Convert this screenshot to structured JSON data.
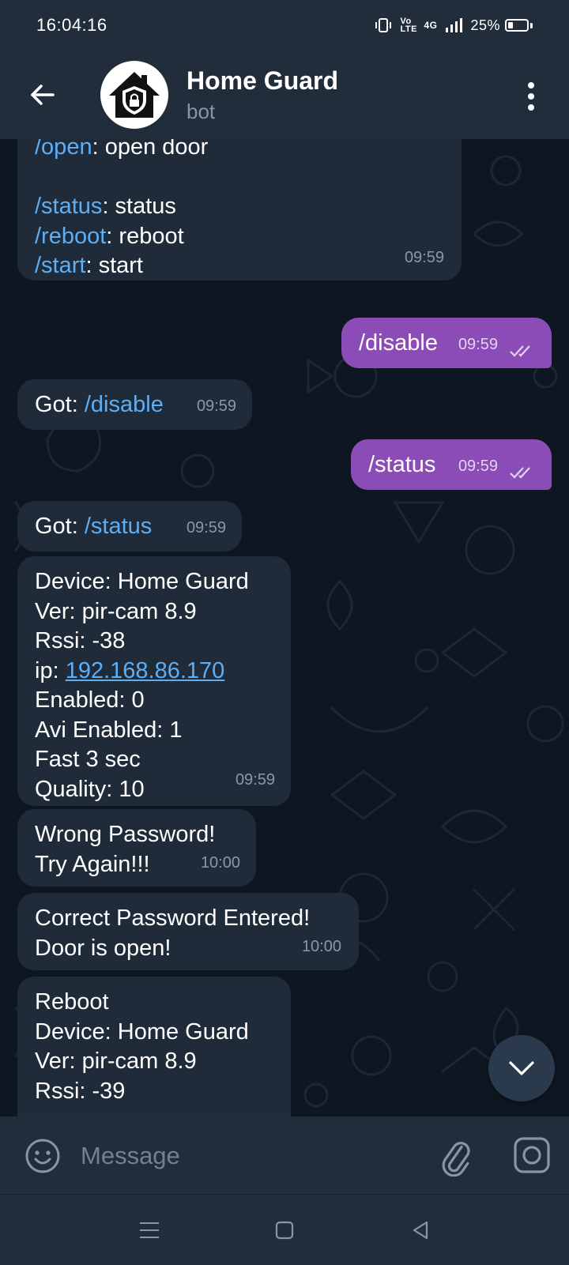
{
  "status_bar": {
    "time": "16:04:16",
    "volte_label": "Vo LTE",
    "network_label": "4G",
    "battery_percent": "25%"
  },
  "header": {
    "title": "Home Guard",
    "subtitle": "bot"
  },
  "messages": [
    {
      "type": "incoming",
      "lines": [
        "/open: open door",
        "",
        "/status: status",
        "/reboot: reboot",
        "/start: start"
      ],
      "time": "09:59",
      "partially_visible": true
    },
    {
      "type": "outgoing",
      "text": "/disable",
      "time": "09:59",
      "read": true
    },
    {
      "type": "incoming",
      "prefix": "Got: ",
      "command": "/disable",
      "time": "09:59"
    },
    {
      "type": "outgoing",
      "text": "/status",
      "time": "09:59",
      "read": true
    },
    {
      "type": "incoming",
      "prefix": "Got: ",
      "command": "/status",
      "time": "09:59"
    },
    {
      "type": "incoming",
      "lines": [
        "Device: Home Guard",
        "Ver: pir-cam 8.9",
        "Rssi: -38",
        "ip: 192.168.86.170",
        "Enabled: 0",
        "Avi Enabled: 1",
        "Fast 3 sec",
        "Quality: 10"
      ],
      "time": "09:59"
    },
    {
      "type": "incoming",
      "lines": [
        "Wrong Password!",
        "Try Again!!!"
      ],
      "time": "10:00"
    },
    {
      "type": "incoming",
      "lines": [
        "Correct Password Entered!",
        "Door is open!"
      ],
      "time": "10:00"
    },
    {
      "type": "incoming",
      "lines": [
        "Reboot",
        "Device: Home Guard",
        "Ver: pir-cam 8.9",
        "Rssi: -39"
      ],
      "partially_visible": true
    }
  ],
  "msg1": {
    "open_cmd": "/open",
    "open_desc": ": open door",
    "status_cmd": "/status",
    "status_desc": ": status",
    "reboot_cmd": "/reboot",
    "reboot_desc": ": reboot",
    "start_cmd": "/start",
    "start_desc": ": start",
    "time": "09:59"
  },
  "msg2": {
    "text": "/disable",
    "time": "09:59"
  },
  "msg3": {
    "prefix": "Got: ",
    "command": "/disable",
    "time": "09:59"
  },
  "msg4": {
    "text": "/status",
    "time": "09:59"
  },
  "msg5": {
    "prefix": "Got: ",
    "command": "/status",
    "time": "09:59"
  },
  "msg6": {
    "line1": "Device: Home Guard",
    "line2": "Ver: pir-cam 8.9",
    "line3": "Rssi: -38",
    "ip_label": "ip: ",
    "ip_value": "192.168.86.170",
    "line5": "Enabled: 0",
    "line6": "Avi Enabled: 1",
    "line7": "Fast 3 sec",
    "line8": "Quality: 10",
    "time": "09:59"
  },
  "msg7": {
    "line1": "Wrong Password!",
    "line2": "Try Again!!!",
    "time": "10:00"
  },
  "msg8": {
    "line1": "Correct Password Entered!",
    "line2": "Door is open!",
    "time": "10:00"
  },
  "msg9": {
    "line1": "Reboot",
    "line2": "Device: Home Guard",
    "line3": "Ver: pir-cam 8.9",
    "line4": "Rssi: -39"
  },
  "composer": {
    "placeholder": "Message"
  },
  "icons": {
    "back": "arrow-left-icon",
    "menu": "more-vertical-icon",
    "emoji": "emoji-icon",
    "attach": "paperclip-icon",
    "camera": "camera-icon",
    "scroll_down": "chevron-down-icon",
    "read_receipt": "double-check-icon"
  },
  "colors": {
    "header_bg": "#212d3b",
    "chat_bg": "#0e1621",
    "incoming_bubble": "#1f2b39",
    "outgoing_bubble": "#8c4cb8",
    "command_link": "#5eaef4"
  }
}
